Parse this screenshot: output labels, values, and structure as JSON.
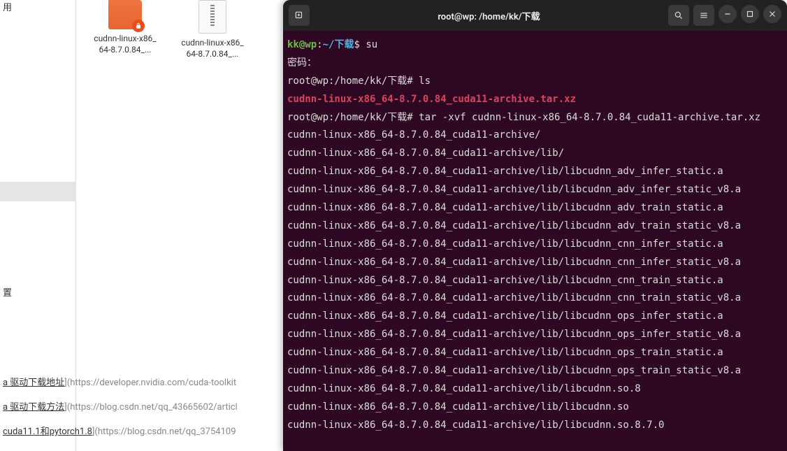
{
  "sidebar": {
    "top_label": "用",
    "settings_label": "置"
  },
  "files": [
    {
      "type": "folder-locked",
      "label": "cudnn-linux-x86_64-8.7.0.84_..."
    },
    {
      "type": "archive",
      "label": "cudnn-linux-x86_64-8.7.0.84_..."
    }
  ],
  "bottom_links": [
    {
      "anchor": "a 驱动下载地址",
      "suffix": "](https://developer.nvidia.com/cuda-toolkit"
    },
    {
      "anchor": "a 驱动下载方法",
      "suffix": "](https://blog.csdn.net/qq_43665602/articl"
    },
    {
      "anchor": "cuda11.1和pytorch1.8",
      "suffix": "](https://blog.csdn.net/qq_3754109"
    }
  ],
  "terminal": {
    "title": "root@wp: /home/kk/下载",
    "session": {
      "user_prompt": {
        "user": "kk@wp",
        "sep": ":",
        "path": "~/下载",
        "end": "$ "
      },
      "su_cmd": "su",
      "password_label": "密码：",
      "root_prompt1": "root@wp:/home/kk/下载# ",
      "ls_cmd": "ls",
      "ls_output": "cudnn-linux-x86_64-8.7.0.84_cuda11-archive.tar.xz",
      "root_prompt2": "root@wp:/home/kk/下载# ",
      "tar_cmd": "tar -xvf cudnn-linux-x86_64-8.7.0.84_cuda11-archive.tar.xz",
      "tar_output": [
        "cudnn-linux-x86_64-8.7.0.84_cuda11-archive/",
        "cudnn-linux-x86_64-8.7.0.84_cuda11-archive/lib/",
        "cudnn-linux-x86_64-8.7.0.84_cuda11-archive/lib/libcudnn_adv_infer_static.a",
        "cudnn-linux-x86_64-8.7.0.84_cuda11-archive/lib/libcudnn_adv_infer_static_v8.a",
        "cudnn-linux-x86_64-8.7.0.84_cuda11-archive/lib/libcudnn_adv_train_static.a",
        "cudnn-linux-x86_64-8.7.0.84_cuda11-archive/lib/libcudnn_adv_train_static_v8.a",
        "cudnn-linux-x86_64-8.7.0.84_cuda11-archive/lib/libcudnn_cnn_infer_static.a",
        "cudnn-linux-x86_64-8.7.0.84_cuda11-archive/lib/libcudnn_cnn_infer_static_v8.a",
        "cudnn-linux-x86_64-8.7.0.84_cuda11-archive/lib/libcudnn_cnn_train_static.a",
        "cudnn-linux-x86_64-8.7.0.84_cuda11-archive/lib/libcudnn_cnn_train_static_v8.a",
        "cudnn-linux-x86_64-8.7.0.84_cuda11-archive/lib/libcudnn_ops_infer_static.a",
        "cudnn-linux-x86_64-8.7.0.84_cuda11-archive/lib/libcudnn_ops_infer_static_v8.a",
        "cudnn-linux-x86_64-8.7.0.84_cuda11-archive/lib/libcudnn_ops_train_static.a",
        "cudnn-linux-x86_64-8.7.0.84_cuda11-archive/lib/libcudnn_ops_train_static_v8.a",
        "cudnn-linux-x86_64-8.7.0.84_cuda11-archive/lib/libcudnn.so.8",
        "cudnn-linux-x86_64-8.7.0.84_cuda11-archive/lib/libcudnn.so",
        "cudnn-linux-x86_64-8.7.0.84_cuda11-archive/lib/libcudnn.so.8.7.0"
      ]
    }
  }
}
